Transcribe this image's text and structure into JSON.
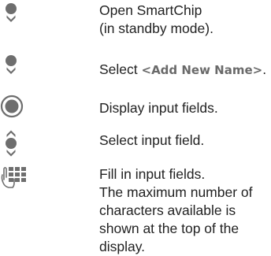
{
  "steps": [
    {
      "icon": "navigation-key-down-icon",
      "lines": [
        "Open SmartChip",
        "(in standby mode)."
      ]
    },
    {
      "icon": "navigation-key-down-icon",
      "prefix": "Select ",
      "softkey": "<Add New Name>",
      "suffix": "."
    },
    {
      "icon": "centre-select-button-icon",
      "lines": [
        "Display input fields."
      ]
    },
    {
      "icon": "navigation-key-up-down-icon",
      "lines": [
        "Select input field."
      ]
    },
    {
      "icon": "keypad-hand-icon",
      "lines": [
        "Fill in input fields.",
        "The maximum number of",
        "characters available is",
        "shown at the top of the",
        "display."
      ]
    }
  ],
  "colors": {
    "text": "#222222",
    "icon": "#6e6e6e",
    "softkey": "#6a6a6a"
  }
}
